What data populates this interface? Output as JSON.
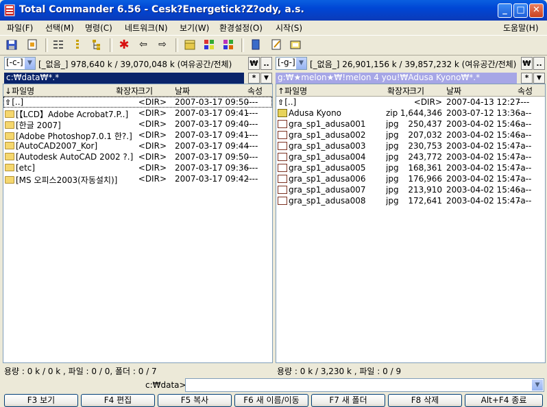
{
  "window": {
    "title": "Total Commander 6.56 - Cesk?Energetick?Z?ody, a.s.",
    "minimize_glyph": "_",
    "maximize_glyph": "□",
    "close_glyph": "✕"
  },
  "menu": {
    "items": [
      "파일(F)",
      "선택(M)",
      "명령(C)",
      "네트워크(N)",
      "보기(W)",
      "환경설정(O)",
      "시작(S)"
    ],
    "help": "도움말(H)"
  },
  "toolbar": {
    "icons": [
      "refresh-icon",
      "quick-view-icon",
      "brief-view-icon",
      "full-view-icon",
      "tree-view-icon",
      "invert-selection-icon",
      "back-icon",
      "forward-icon",
      "pack-icon",
      "unpack-icon",
      "find-icon",
      "copy-names-icon",
      "edit-icon",
      "notepad-icon"
    ]
  },
  "left": {
    "drive": "[-c-]",
    "drive_info": "[_없음_]  978,640 k / 39,070,048 k (여유공간/전체)",
    "root_btn": "₩",
    "up_btn": "..",
    "path": "c:₩data₩*.*",
    "filter_btn": "*",
    "hist_btn": "▼",
    "columns": {
      "name": "↓파일명",
      "ext": "확장자",
      "size": "크기",
      "date": "날짜",
      "attr": "속성"
    },
    "rows": [
      {
        "icon": "up",
        "name": "[..]",
        "ext": "",
        "size": "<DIR>",
        "date": "2007-03-17 09:50",
        "attr": "----"
      },
      {
        "icon": "folder",
        "name": "[【LCD】Adobe Acrobat7.P..]",
        "ext": "",
        "size": "<DIR>",
        "date": "2007-03-17 09:41",
        "attr": "----"
      },
      {
        "icon": "folder",
        "name": "[한글 2007]",
        "ext": "",
        "size": "<DIR>",
        "date": "2007-03-17 09:40",
        "attr": "----"
      },
      {
        "icon": "folder",
        "name": "[Adobe Photoshop7.0.1 한?.]",
        "ext": "",
        "size": "<DIR>",
        "date": "2007-03-17 09:41",
        "attr": "----"
      },
      {
        "icon": "folder",
        "name": "[AutoCAD2007_Kor]",
        "ext": "",
        "size": "<DIR>",
        "date": "2007-03-17 09:44",
        "attr": "----"
      },
      {
        "icon": "folder",
        "name": "[Autodesk AutoCAD 2002 ?.]",
        "ext": "",
        "size": "<DIR>",
        "date": "2007-03-17 09:50",
        "attr": "----"
      },
      {
        "icon": "folder",
        "name": "[etc]",
        "ext": "",
        "size": "<DIR>",
        "date": "2007-03-17 09:36",
        "attr": "----"
      },
      {
        "icon": "folder",
        "name": "[MS 오피스2003(자동설치)]",
        "ext": "",
        "size": "<DIR>",
        "date": "2007-03-17 09:42",
        "attr": "----"
      }
    ],
    "status": "용량 : 0 k / 0 k , 파일 : 0 / 0, 폴더 : 0 / 7"
  },
  "right": {
    "drive": "[-g-]",
    "drive_info": "[_없음_]  26,901,156 k / 39,857,232 k (여유공간/전체)",
    "root_btn": "₩",
    "up_btn": "..",
    "path": "g:₩★melon★₩!melon 4 you!₩Adusa Kyono₩*.*",
    "filter_btn": "*",
    "hist_btn": "▼",
    "columns": {
      "name": "↑파일명",
      "ext": "확장자",
      "size": "크기",
      "date": "날짜",
      "attr": "속성"
    },
    "rows": [
      {
        "icon": "up",
        "name": "[..]",
        "ext": "",
        "size": "<DIR>",
        "date": "2007-04-13 12:27",
        "attr": "----"
      },
      {
        "icon": "zip",
        "name": "Adusa Kyono",
        "ext": "zip",
        "size": "1,644,346",
        "date": "2003-07-12 13:36",
        "attr": "-a--"
      },
      {
        "icon": "jpg",
        "name": "gra_sp1_adusa001",
        "ext": "jpg",
        "size": "250,437",
        "date": "2003-04-02 15:46",
        "attr": "-a--"
      },
      {
        "icon": "jpg",
        "name": "gra_sp1_adusa002",
        "ext": "jpg",
        "size": "207,032",
        "date": "2003-04-02 15:46",
        "attr": "-a--"
      },
      {
        "icon": "jpg",
        "name": "gra_sp1_adusa003",
        "ext": "jpg",
        "size": "230,753",
        "date": "2003-04-02 15:47",
        "attr": "-a--"
      },
      {
        "icon": "jpg",
        "name": "gra_sp1_adusa004",
        "ext": "jpg",
        "size": "243,772",
        "date": "2003-04-02 15:47",
        "attr": "-a--"
      },
      {
        "icon": "jpg",
        "name": "gra_sp1_adusa005",
        "ext": "jpg",
        "size": "168,361",
        "date": "2003-04-02 15:47",
        "attr": "-a--"
      },
      {
        "icon": "jpg",
        "name": "gra_sp1_adusa006",
        "ext": "jpg",
        "size": "176,966",
        "date": "2003-04-02 15:47",
        "attr": "-a--"
      },
      {
        "icon": "jpg",
        "name": "gra_sp1_adusa007",
        "ext": "jpg",
        "size": "213,910",
        "date": "2003-04-02 15:46",
        "attr": "-a--"
      },
      {
        "icon": "jpg",
        "name": "gra_sp1_adusa008",
        "ext": "jpg",
        "size": "172,641",
        "date": "2003-04-02 15:47",
        "attr": "-a--"
      }
    ],
    "status": "용량 : 0 k / 3,230 k , 파일 : 0 / 9"
  },
  "cmdline": {
    "label": "c:₩data>",
    "value": "",
    "arrow": "▼"
  },
  "fkeys": [
    "F3 보기",
    "F4 편집",
    "F5 복사",
    "F6 새 이름/이동",
    "F7 새 폴더",
    "F8 삭제",
    "Alt+F4 종료"
  ],
  "colors": {
    "active_path": "#0A246A",
    "inactive_path": "#A6A6E6"
  }
}
